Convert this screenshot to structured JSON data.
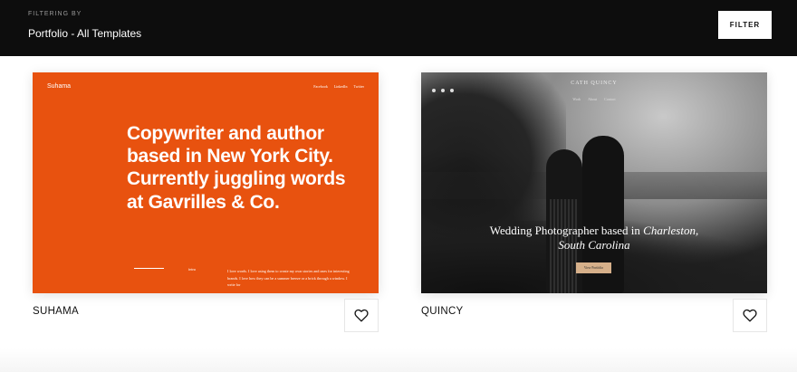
{
  "header": {
    "filtering_label": "FILTERING BY",
    "filter_value": "Portfolio - All Templates",
    "filter_button": "FILTER"
  },
  "templates": [
    {
      "name": "SUHAMA",
      "preview": {
        "logo": "Suhama",
        "nav": [
          "Facebook",
          "LinkedIn",
          "Twitter"
        ],
        "headline": "Copywriter and author based in New York City. Currently juggling words at Gavrilles & Co.",
        "tag": "Intro",
        "body": "I love words. I love using them to create my own stories and ones for interesting brands. I love how they can be a summer breeze or a brick through a window. I write for",
        "accent": "#e8520f"
      },
      "favorite_icon": "heart-icon"
    },
    {
      "name": "QUINCY",
      "preview": {
        "brand": "CATH QUINCY",
        "nav": [
          "Work",
          "About",
          "Contact"
        ],
        "headline_plain": "Wedding Photographer based in ",
        "headline_italic_1": "Charleston,",
        "headline_italic_2": "South Carolina",
        "cta": "View Portfolio",
        "accent": "#d6b08a"
      },
      "favorite_icon": "heart-icon"
    }
  ]
}
